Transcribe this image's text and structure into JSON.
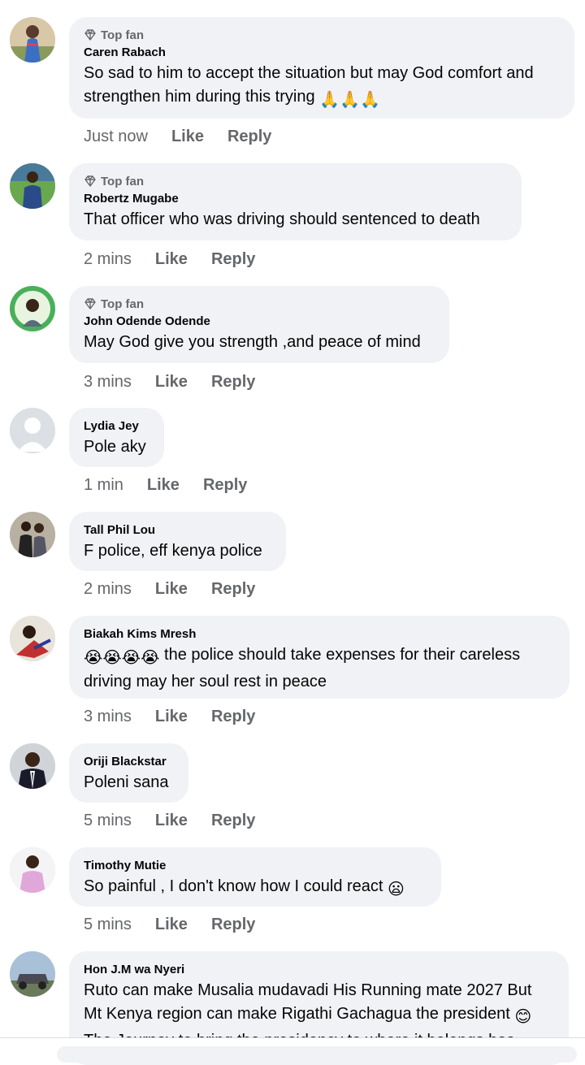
{
  "badge_label": "Top fan",
  "comments": [
    {
      "name": "Caren Rabach",
      "top_fan": true,
      "text": "So sad to him to accept the situation but may God comfort and strengthen him  during this trying",
      "emoji": "🙏🙏🙏",
      "time": "Just now",
      "like": "Like",
      "reply": "Reply"
    },
    {
      "name": "Robertz Mugabe",
      "top_fan": true,
      "text": "That officer who was driving should sentenced to death",
      "time": "2 mins",
      "like": "Like",
      "reply": "Reply"
    },
    {
      "name": "John Odende Odende",
      "top_fan": true,
      "text": "May God give you strength ,and peace of mind",
      "time": "3 mins",
      "like": "Like",
      "reply": "Reply"
    },
    {
      "name": "Lydia Jey",
      "top_fan": false,
      "text": "Pole aky",
      "time": "1 min",
      "like": "Like",
      "reply": "Reply"
    },
    {
      "name": "Tall Phil Lou",
      "top_fan": false,
      "text": "F police, eff kenya police",
      "time": "2 mins",
      "like": "Like",
      "reply": "Reply"
    },
    {
      "name": "Biakah Kims Mresh",
      "top_fan": false,
      "emoji_prefix": "😭😭😭😭",
      "text": " the police should take expenses for their careless driving may her soul rest in peace",
      "time": "3 mins",
      "like": "Like",
      "reply": "Reply"
    },
    {
      "name": "Oriji Blackstar",
      "top_fan": false,
      "text": "Poleni sana",
      "time": "5 mins",
      "like": "Like",
      "reply": "Reply"
    },
    {
      "name": "Timothy Mutie",
      "top_fan": false,
      "text": "So painful , I don't know how I could react ",
      "emoji": "😦",
      "time": "5 mins",
      "like": "Like",
      "reply": "Reply"
    },
    {
      "name": "Hon J.M wa Nyeri",
      "top_fan": false,
      "text": "Ruto can make Musalia mudavadi His Running mate 2027 But Mt Kenya region can make Rigathi Gachagua the president ",
      "emoji": "😊",
      "text2": "The Journey to bring the presidency to where it belongs has"
    }
  ]
}
